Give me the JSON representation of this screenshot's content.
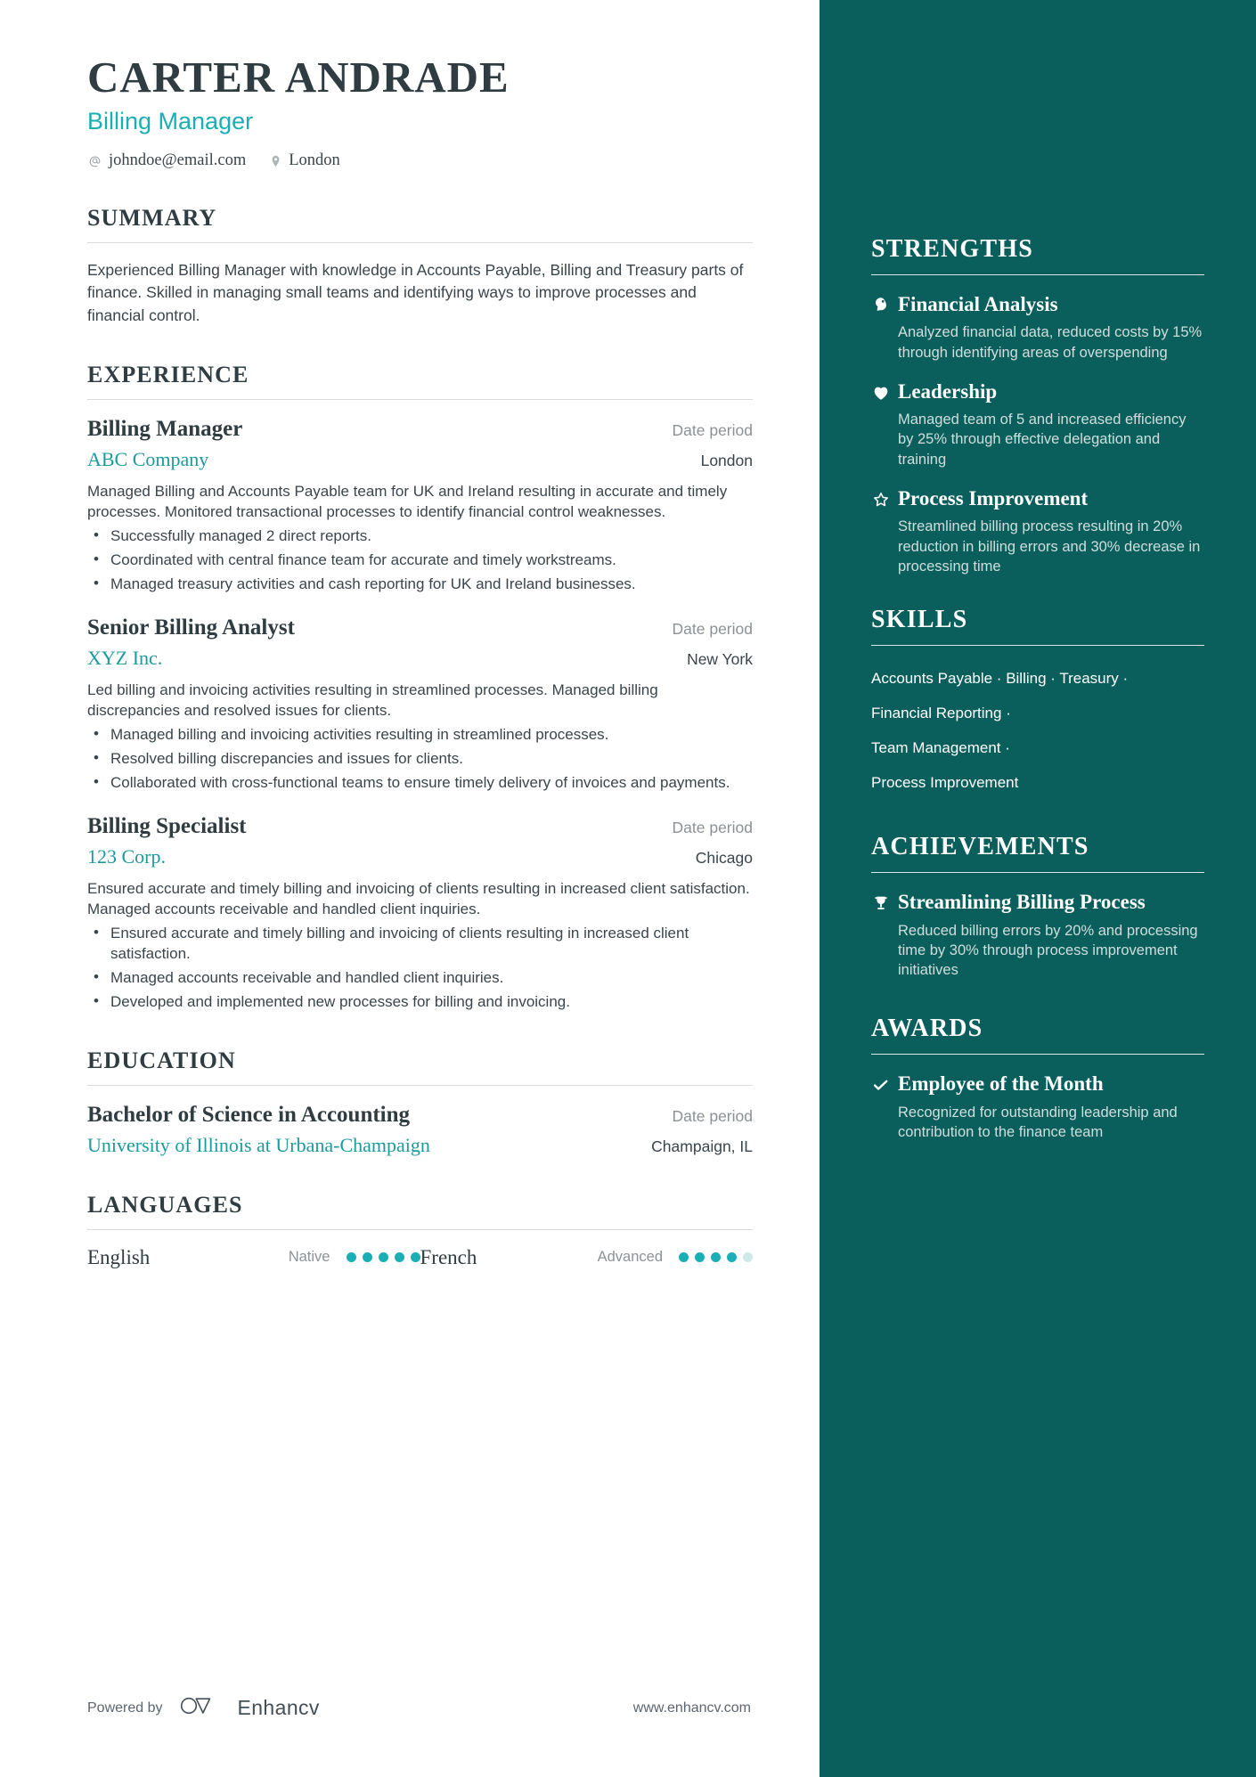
{
  "header": {
    "name": "CARTER ANDRADE",
    "role": "Billing Manager",
    "email": "johndoe@email.com",
    "location": "London",
    "email_icon": "at-icon",
    "location_icon": "map-pin-icon"
  },
  "summary": {
    "title": "SUMMARY",
    "text": "Experienced Billing Manager with knowledge in Accounts Payable, Billing and Treasury parts of finance. Skilled in managing small teams and identifying ways to improve processes and financial control."
  },
  "experience": {
    "title": "EXPERIENCE",
    "entries": [
      {
        "position": "Billing Manager",
        "company": "ABC Company",
        "date": "Date period",
        "location": "London",
        "description": "Managed Billing and Accounts Payable team for UK and Ireland resulting in accurate and timely processes. Monitored transactional processes to identify financial control weaknesses.",
        "bullets": [
          "Successfully managed 2 direct reports.",
          "Coordinated with central finance team for accurate and timely workstreams.",
          "Managed treasury activities and cash reporting for UK and Ireland businesses."
        ]
      },
      {
        "position": "Senior Billing Analyst",
        "company": "XYZ Inc.",
        "date": "Date period",
        "location": "New York",
        "description": "Led billing and invoicing activities resulting in streamlined processes. Managed billing discrepancies and resolved issues for clients.",
        "bullets": [
          "Managed billing and invoicing activities resulting in streamlined processes.",
          "Resolved billing discrepancies and issues for clients.",
          "Collaborated with cross-functional teams to ensure timely delivery of invoices and payments."
        ]
      },
      {
        "position": "Billing Specialist",
        "company": "123 Corp.",
        "date": "Date period",
        "location": "Chicago",
        "description": "Ensured accurate and timely billing and invoicing of clients resulting in increased client satisfaction. Managed accounts receivable and handled client inquiries.",
        "bullets": [
          "Ensured accurate and timely billing and invoicing of clients resulting in increased client satisfaction.",
          "Managed accounts receivable and handled client inquiries.",
          "Developed and implemented new processes for billing and invoicing."
        ]
      }
    ]
  },
  "education": {
    "title": "EDUCATION",
    "entries": [
      {
        "degree": "Bachelor of Science in Accounting",
        "school": "University of Illinois at Urbana-Champaign",
        "date": "Date period",
        "location": "Champaign, IL"
      }
    ]
  },
  "languages": {
    "title": "LANGUAGES",
    "items": [
      {
        "name": "English",
        "level": "Native",
        "filled": 5,
        "total": 5
      },
      {
        "name": "French",
        "level": "Advanced",
        "filled": 4,
        "total": 5
      }
    ]
  },
  "strengths": {
    "title": "STRENGTHS",
    "entries": [
      {
        "icon": "brain-icon",
        "title": "Financial Analysis",
        "description": "Analyzed financial data, reduced costs by 15% through identifying areas of overspending"
      },
      {
        "icon": "heart-icon",
        "title": "Leadership",
        "description": "Managed team of 5 and increased efficiency by 25% through effective delegation and training"
      },
      {
        "icon": "star-outline-icon",
        "title": "Process Improvement",
        "description": "Streamlined billing process resulting in 20% reduction in billing errors and 30% decrease in processing time"
      }
    ]
  },
  "skills": {
    "title": "SKILLS",
    "lines": [
      "Accounts Payable · Billing · Treasury ·",
      "Financial Reporting ·",
      "Team Management ·",
      "Process Improvement"
    ]
  },
  "achievements": {
    "title": "ACHIEVEMENTS",
    "entries": [
      {
        "icon": "trophy-icon",
        "title": "Streamlining Billing Process",
        "description": "Reduced billing errors by 20% and processing time by 30% through process improvement initiatives"
      }
    ]
  },
  "awards": {
    "title": "AWARDS",
    "entries": [
      {
        "icon": "check-icon",
        "title": "Employee of the Month",
        "description": "Recognized for outstanding leadership and contribution to the finance team"
      }
    ]
  },
  "footer": {
    "powered_by": "Powered by",
    "brand": "Enhancv",
    "website": "www.enhancv.com"
  },
  "colors": {
    "sidebar_bg": "#0a5f5c",
    "accent": "#1aafb4",
    "accent_dark": "#1d9a9e",
    "ink": "#2f3c42"
  }
}
